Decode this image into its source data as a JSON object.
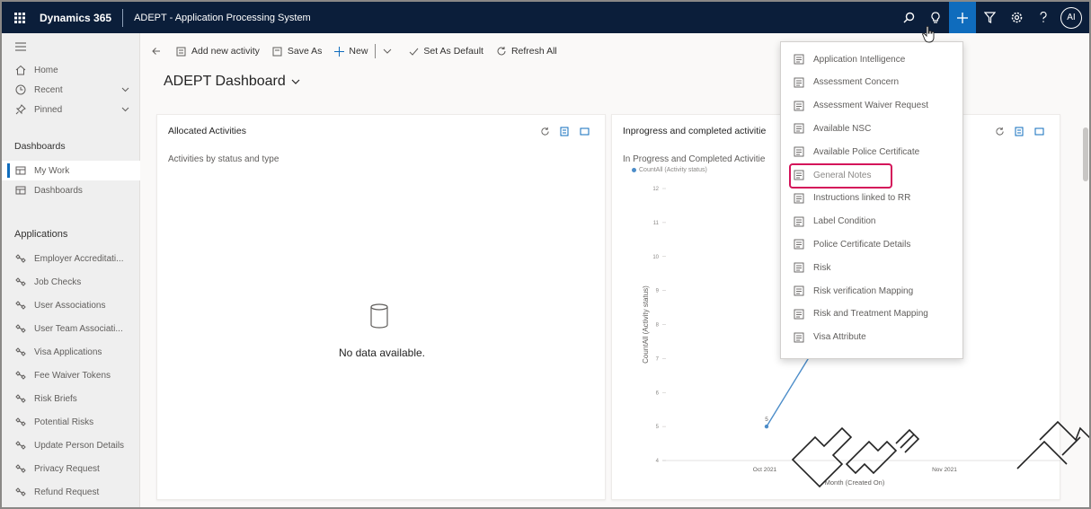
{
  "topbar": {
    "app_name": "Dynamics 365",
    "area_name": "ADEPT - Application Processing System",
    "avatar_initials": "AI",
    "bg_color": "#0b1e3a",
    "active_color": "#0f6cbd"
  },
  "sidebar": {
    "nav": [
      {
        "label": "Home",
        "icon": "home-icon"
      },
      {
        "label": "Recent",
        "icon": "clock-icon"
      },
      {
        "label": "Pinned",
        "icon": "pin-icon"
      }
    ],
    "dashboards_header": "Dashboards",
    "dashboards": [
      {
        "label": "My Work",
        "icon": "dashboard-icon",
        "selected": true
      },
      {
        "label": "Dashboards",
        "icon": "dashboard-icon"
      }
    ],
    "applications_header": "Applications",
    "applications": [
      "Employer Accreditati...",
      "Job Checks",
      "User Associations",
      "User Team Associati...",
      "Visa Applications",
      "Fee Waiver Tokens",
      "Risk Briefs",
      "Potential Risks",
      "Update Person Details",
      "Privacy Request",
      "Refund Request"
    ]
  },
  "commandbar": {
    "add_new_activity": "Add new activity",
    "save_as": "Save As",
    "new": "New",
    "set_as_default": "Set As Default",
    "refresh_all": "Refresh All"
  },
  "dashboard": {
    "title": "ADEPT Dashboard"
  },
  "card1": {
    "title": "Allocated Activities",
    "subtitle": "Activities by status and type",
    "empty_text": "No data available."
  },
  "card2": {
    "title": "Inprogress and completed activitie",
    "subtitle": "In Progress and Completed Activitie",
    "legend": "CountAll (Activity status)"
  },
  "chart_data": {
    "type": "line",
    "ylabel": "CountAll (Activity status)",
    "xlabel": "Month (Created On)",
    "x": [
      "Oct 2021",
      "Nov 2021"
    ],
    "y_ticks": [
      4,
      5,
      6,
      7,
      8,
      9,
      10,
      11,
      12
    ],
    "visible_point": {
      "x": "Oct 2021",
      "y": 5,
      "label": "5"
    },
    "ylim": [
      4,
      12
    ]
  },
  "create_menu": {
    "items": [
      "Application Intelligence",
      "Assessment Concern",
      "Assessment Waiver Request",
      "Available NSC",
      "Available Police Certificate",
      "General Notes",
      "Instructions linked to RR",
      "Label Condition",
      "Police Certificate Details",
      "Risk",
      "Risk verification Mapping",
      "Risk and Treatment Mapping",
      "Visa Attribute"
    ],
    "highlighted": "General Notes",
    "highlight_color": "#d4145a"
  }
}
